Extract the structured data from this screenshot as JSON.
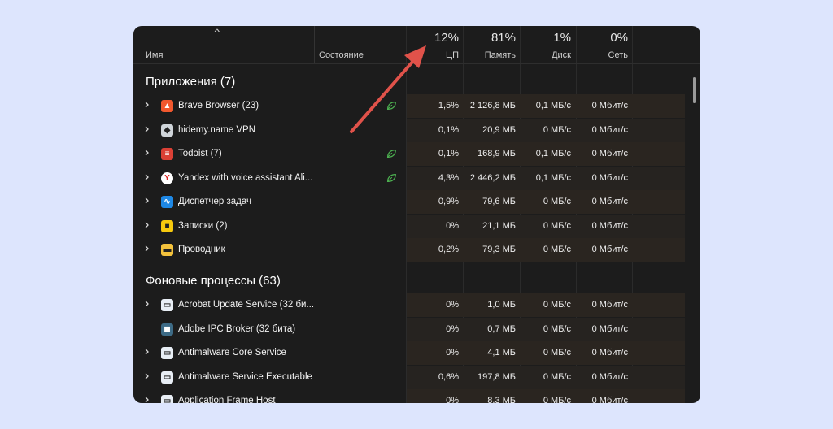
{
  "header": {
    "name_label": "Имя",
    "status_label": "Состояние",
    "cpu": {
      "pct": "12%",
      "label": "ЦП"
    },
    "memory": {
      "pct": "81%",
      "label": "Память"
    },
    "disk": {
      "pct": "1%",
      "label": "Диск"
    },
    "network": {
      "pct": "0%",
      "label": "Сеть"
    }
  },
  "apps": {
    "title": "Приложения (7)",
    "rows": [
      {
        "name": "Brave Browser (23)",
        "icon": "brave-icon",
        "eco": true,
        "cpu": "1,5%",
        "memory": "2 126,8 МБ",
        "disk": "0,1 МБ/с",
        "network": "0 Мбит/с"
      },
      {
        "name": "hidemy.name VPN",
        "icon": "hidemy-icon",
        "eco": false,
        "cpu": "0,1%",
        "memory": "20,9 МБ",
        "disk": "0 МБ/с",
        "network": "0 Мбит/с"
      },
      {
        "name": "Todoist (7)",
        "icon": "todoist-icon",
        "eco": true,
        "cpu": "0,1%",
        "memory": "168,9 МБ",
        "disk": "0,1 МБ/с",
        "network": "0 Мбит/с"
      },
      {
        "name": "Yandex with voice assistant Ali...",
        "icon": "yandex-icon",
        "eco": true,
        "cpu": "4,3%",
        "memory": "2 446,2 МБ",
        "disk": "0,1 МБ/с",
        "network": "0 Мбит/с"
      },
      {
        "name": "Диспетчер задач",
        "icon": "task-manager-icon",
        "eco": false,
        "cpu": "0,9%",
        "memory": "79,6 МБ",
        "disk": "0 МБ/с",
        "network": "0 Мбит/с"
      },
      {
        "name": "Записки (2)",
        "icon": "sticky-notes-icon",
        "eco": false,
        "cpu": "0%",
        "memory": "21,1 МБ",
        "disk": "0 МБ/с",
        "network": "0 Мбит/с"
      },
      {
        "name": "Проводник",
        "icon": "explorer-icon",
        "eco": false,
        "cpu": "0,2%",
        "memory": "79,3 МБ",
        "disk": "0 МБ/с",
        "network": "0 Мбит/с"
      }
    ]
  },
  "background": {
    "title": "Фоновые процессы (63)",
    "rows": [
      {
        "name": "Acrobat Update Service (32 би...",
        "icon": "service-icon",
        "cpu": "0%",
        "memory": "1,0 МБ",
        "disk": "0 МБ/с",
        "network": "0 Мбит/с"
      },
      {
        "name": "Adobe IPC Broker (32 бита)",
        "icon": "adobe-icon",
        "cpu": "0%",
        "memory": "0,7 МБ",
        "disk": "0 МБ/с",
        "network": "0 Мбит/с"
      },
      {
        "name": "Antimalware Core Service",
        "icon": "service-icon",
        "cpu": "0%",
        "memory": "4,1 МБ",
        "disk": "0 МБ/с",
        "network": "0 Мбит/с"
      },
      {
        "name": "Antimalware Service Executable",
        "icon": "service-icon",
        "cpu": "0,6%",
        "memory": "197,8 МБ",
        "disk": "0 МБ/с",
        "network": "0 Мбит/с"
      },
      {
        "name": "Application Frame Host",
        "icon": "service-icon",
        "cpu": "0%",
        "memory": "8,3 МБ",
        "disk": "0 МБ/с",
        "network": "0 Мбит/с"
      }
    ]
  },
  "colors": {
    "arrow": "#e0524a",
    "eco_leaf": "#4caf50",
    "heat": "#2a2520"
  }
}
